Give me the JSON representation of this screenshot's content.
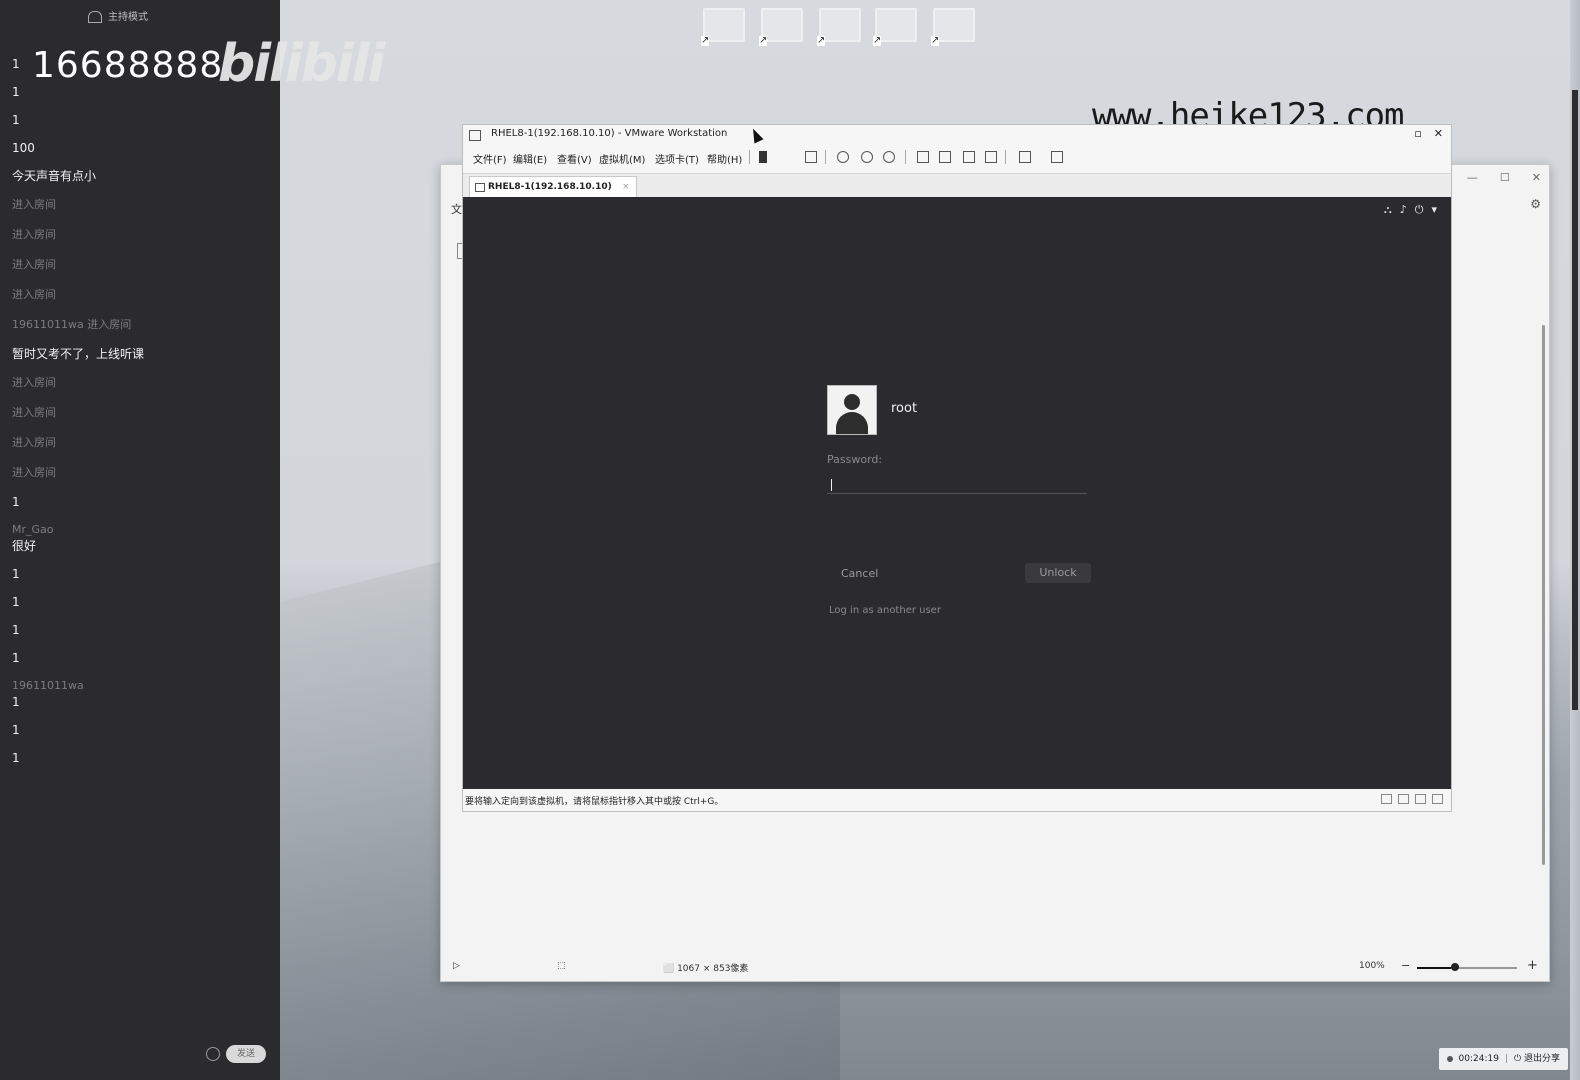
{
  "stream": {
    "mode_label": "主持模式",
    "room_number": "16688888",
    "logo_text": "bilibili",
    "watermark": "www.heike123.com"
  },
  "chat": {
    "messages": [
      {
        "nick": "",
        "text": "1"
      },
      {
        "nick": "",
        "text": "1"
      },
      {
        "nick": "",
        "text": "1"
      },
      {
        "nick": "",
        "text": "100"
      },
      {
        "nick": "",
        "text": "今天声音有点小"
      },
      {
        "nick": "进入房间",
        "text": ""
      },
      {
        "nick": "进入房间",
        "text": ""
      },
      {
        "nick": "进入房间",
        "text": ""
      },
      {
        "nick": "进入房间",
        "text": ""
      },
      {
        "nick": "19611011wa 进入房间",
        "text": ""
      },
      {
        "nick": "",
        "text": "暂时又考不了，上线听课"
      },
      {
        "nick": "进入房间",
        "text": ""
      },
      {
        "nick": "进入房间",
        "text": ""
      },
      {
        "nick": "进入房间",
        "text": ""
      },
      {
        "nick": "进入房间",
        "text": ""
      },
      {
        "nick": "",
        "text": "1"
      },
      {
        "nick": "Mr_Gao",
        "text": "很好"
      },
      {
        "nick": "",
        "text": "1"
      },
      {
        "nick": "",
        "text": "1"
      },
      {
        "nick": "",
        "text": "1"
      },
      {
        "nick": "",
        "text": "1"
      },
      {
        "nick": "19611011wa",
        "text": "1"
      },
      {
        "nick": "",
        "text": "1"
      },
      {
        "nick": "",
        "text": "1"
      }
    ],
    "send_label": "发送"
  },
  "desktop_icons": [
    {
      "label": "",
      "icon": "shortcut-icon"
    },
    {
      "label": "",
      "icon": "shortcut-icon"
    },
    {
      "label": "",
      "icon": "shortcut-icon"
    },
    {
      "label": "",
      "icon": "shortcut-icon"
    },
    {
      "label": "",
      "icon": "shortcut-icon"
    }
  ],
  "back_window": {
    "menu_first": "文",
    "status": {
      "size_text": "1067 × 853像素",
      "zoom_text": "100%",
      "zoom_level": 0.34
    }
  },
  "vmware": {
    "title": "RHEL8-1(192.168.10.10) - VMware Workstation",
    "menus": [
      "文件(F)",
      "编辑(E)",
      "查看(V)",
      "虚拟机(M)",
      "选项卡(T)",
      "帮助(H)"
    ],
    "tab_label": "RHEL8-1(192.168.10.10)",
    "status_message": "要将输入定向到该虚拟机，请将鼠标指针移入其中或按 Ctrl+G。"
  },
  "lock_screen": {
    "username": "root",
    "password_label": "Password:",
    "password_value": "",
    "cancel_label": "Cancel",
    "unlock_label": "Unlock",
    "other_user_link": "Log in as another user"
  },
  "recording": {
    "elapsed": "00:24:19",
    "stop_label": "退出分享"
  }
}
